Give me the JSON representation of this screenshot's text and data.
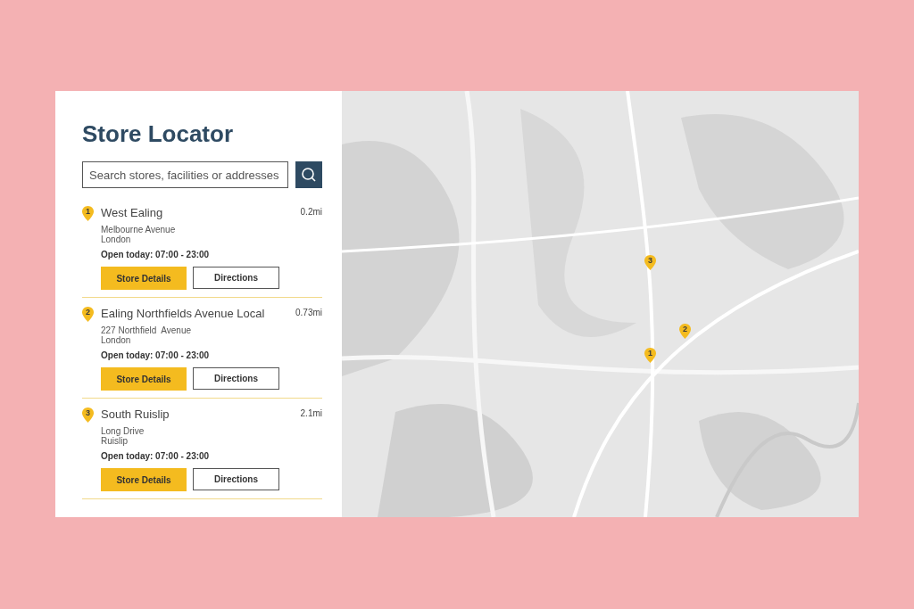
{
  "title": "Store Locator",
  "search": {
    "placeholder": "Search stores, facilities or addresses"
  },
  "stores": [
    {
      "number": "1",
      "name": "West Ealing",
      "distance": "0.2mi",
      "address": [
        "Melbourne Avenue",
        "London"
      ],
      "hours": "Open today: 07:00 - 23:00",
      "buttons": [
        "Store Details",
        "Directions"
      ]
    },
    {
      "number": "2",
      "name": "Ealing Northfields Avenue Local",
      "distance": "0.73mi",
      "address": [
        "227 Northfield  Avenue",
        "London"
      ],
      "hours": "Open today: 07:00 - 23:00",
      "buttons": [
        "Store Details",
        "Directions"
      ]
    },
    {
      "number": "3",
      "name": "South Ruislip",
      "distance": "2.1mi",
      "address": [
        "Long Drive",
        "Ruislip"
      ],
      "hours": "Open today: 07:00 - 23:00",
      "buttons": [
        "Store Details",
        "Directions"
      ]
    }
  ],
  "map": {
    "pins": [
      "1",
      "2",
      "3"
    ]
  }
}
